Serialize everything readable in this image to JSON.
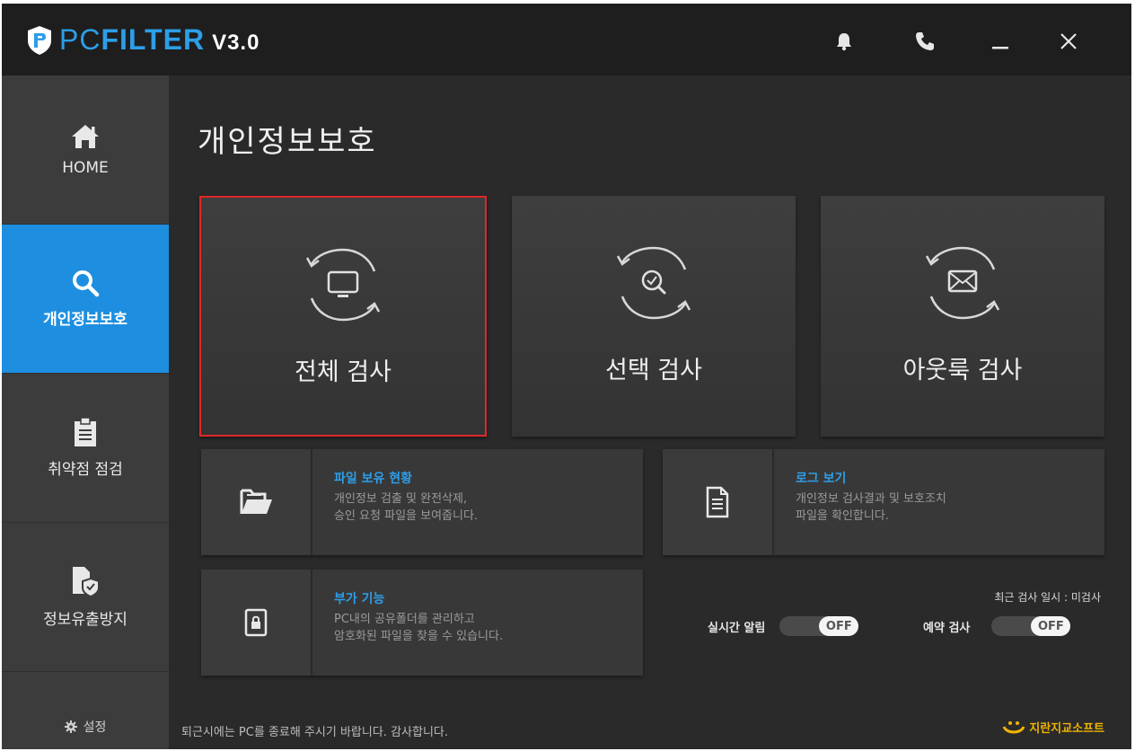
{
  "app": {
    "logo_pc": "PC",
    "logo_filter": "FILTER",
    "version": "V3.0"
  },
  "titlebar": {
    "icons": [
      "bell-icon",
      "phone-icon",
      "minimize-icon",
      "close-icon"
    ]
  },
  "sidebar": {
    "items": [
      {
        "label": "HOME",
        "icon": "home-icon"
      },
      {
        "label": "개인정보보호",
        "icon": "search-icon"
      },
      {
        "label": "취약점 점검",
        "icon": "clipboard-icon"
      },
      {
        "label": "정보유출방지",
        "icon": "file-shield-icon"
      }
    ],
    "active_index": 1,
    "settings_label": "설정"
  },
  "main": {
    "title": "개인정보보호",
    "scan_cards": [
      {
        "label": "전체 검사",
        "icon": "monitor-cycle-icon"
      },
      {
        "label": "선택 검사",
        "icon": "magnifier-cycle-icon"
      },
      {
        "label": "아웃룩 검사",
        "icon": "mail-cycle-icon"
      }
    ],
    "feature_cards": [
      {
        "title": "파일 보유 현황",
        "line1": "개인정보 검출 및 완전삭제,",
        "line2": "승인 요청 파일을 보여줍니다.",
        "icon": "folder-icon"
      },
      {
        "title": "로그 보기",
        "line1": "개인정보 검사결과 및 보호조치",
        "line2": "파일을 확인합니다.",
        "icon": "document-icon"
      },
      {
        "title": "부가 기능",
        "line1": "PC내의 공유폴더를 관리하고",
        "line2": "암호화된 파일을 찾을 수 있습니다.",
        "icon": "lock-file-icon"
      }
    ],
    "recent_scan": "최근 검사 일시 : 미검사",
    "realtime_alert_label": "실시간 알림",
    "realtime_alert_state": "OFF",
    "scheduled_scan_label": "예약 검사",
    "scheduled_scan_state": "OFF"
  },
  "footer": {
    "message": "퇴근시에는 PC를 종료해 주시기 바랍니다. 감사합니다.",
    "brand": "지란지교소프트"
  },
  "colors": {
    "accent": "#1e8fe0",
    "selected_border": "#e0282a",
    "brand": "#f0b400"
  }
}
